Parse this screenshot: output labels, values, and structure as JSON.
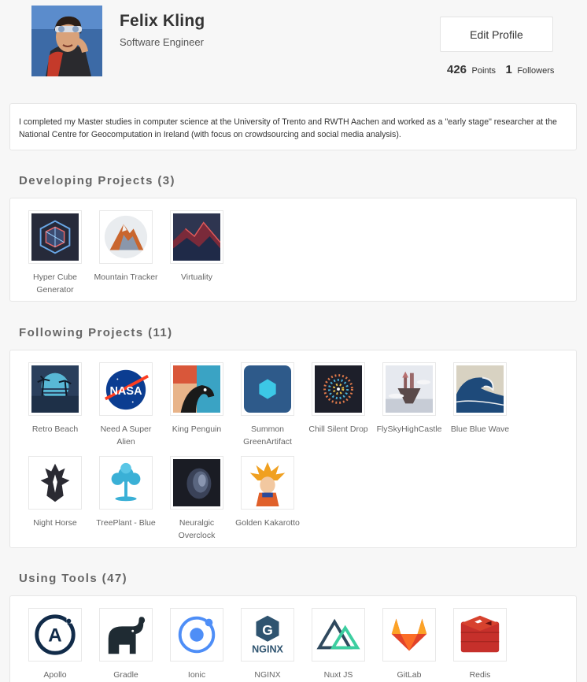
{
  "profile": {
    "name": "Felix Kling",
    "role": "Software Engineer",
    "edit_label": "Edit Profile",
    "points_value": "426",
    "points_label": "Points",
    "followers_value": "1",
    "followers_label": "Followers",
    "bio": "I completed my Master studies in computer science at the University of Trento and RWTH Aachen and worked as a \"early stage\" researcher at the National Centre for Geocomputation in Ireland (with focus on crowdsourcing and social media analysis)."
  },
  "developing": {
    "title": "Developing Projects (3)",
    "items": [
      {
        "label": "Hyper Cube Generator",
        "icon": "hyper-cube-icon"
      },
      {
        "label": "Mountain Tracker",
        "icon": "mountain-icon"
      },
      {
        "label": "Virtuality",
        "icon": "virtuality-icon"
      }
    ]
  },
  "following": {
    "title": "Following Projects (11)",
    "items": [
      {
        "label": "Retro Beach",
        "icon": "retro-beach-icon"
      },
      {
        "label": "Need A Super Alien",
        "icon": "nasa-icon"
      },
      {
        "label": "King Penguin",
        "icon": "penguin-icon"
      },
      {
        "label": "Summon GreenArtifact",
        "icon": "hexagon-icon"
      },
      {
        "label": "Chill Silent Drop",
        "icon": "dots-spiral-icon"
      },
      {
        "label": "FlySkyHighCastle",
        "icon": "floating-castle-icon"
      },
      {
        "label": "Blue Blue Wave",
        "icon": "wave-icon"
      },
      {
        "label": "Night Horse",
        "icon": "night-horse-icon"
      },
      {
        "label": "TreePlant - Blue",
        "icon": "tree-icon"
      },
      {
        "label": "Neuralgic Overclock",
        "icon": "neuralgic-icon"
      },
      {
        "label": "Golden Kakarotto",
        "icon": "kakarotto-icon"
      }
    ]
  },
  "tools": {
    "title": "Using Tools (47)",
    "items": [
      {
        "label": "Apollo",
        "icon": "apollo-icon",
        "logo_text": "A"
      },
      {
        "label": "Gradle",
        "icon": "gradle-icon"
      },
      {
        "label": "Ionic",
        "icon": "ionic-icon"
      },
      {
        "label": "NGINX",
        "icon": "nginx-icon",
        "logo_text": "NGINX",
        "logo_letter": "G"
      },
      {
        "label": "Nuxt JS",
        "icon": "nuxt-icon"
      },
      {
        "label": "GitLab",
        "icon": "gitlab-icon"
      },
      {
        "label": "Redis",
        "icon": "redis-icon"
      }
    ]
  }
}
